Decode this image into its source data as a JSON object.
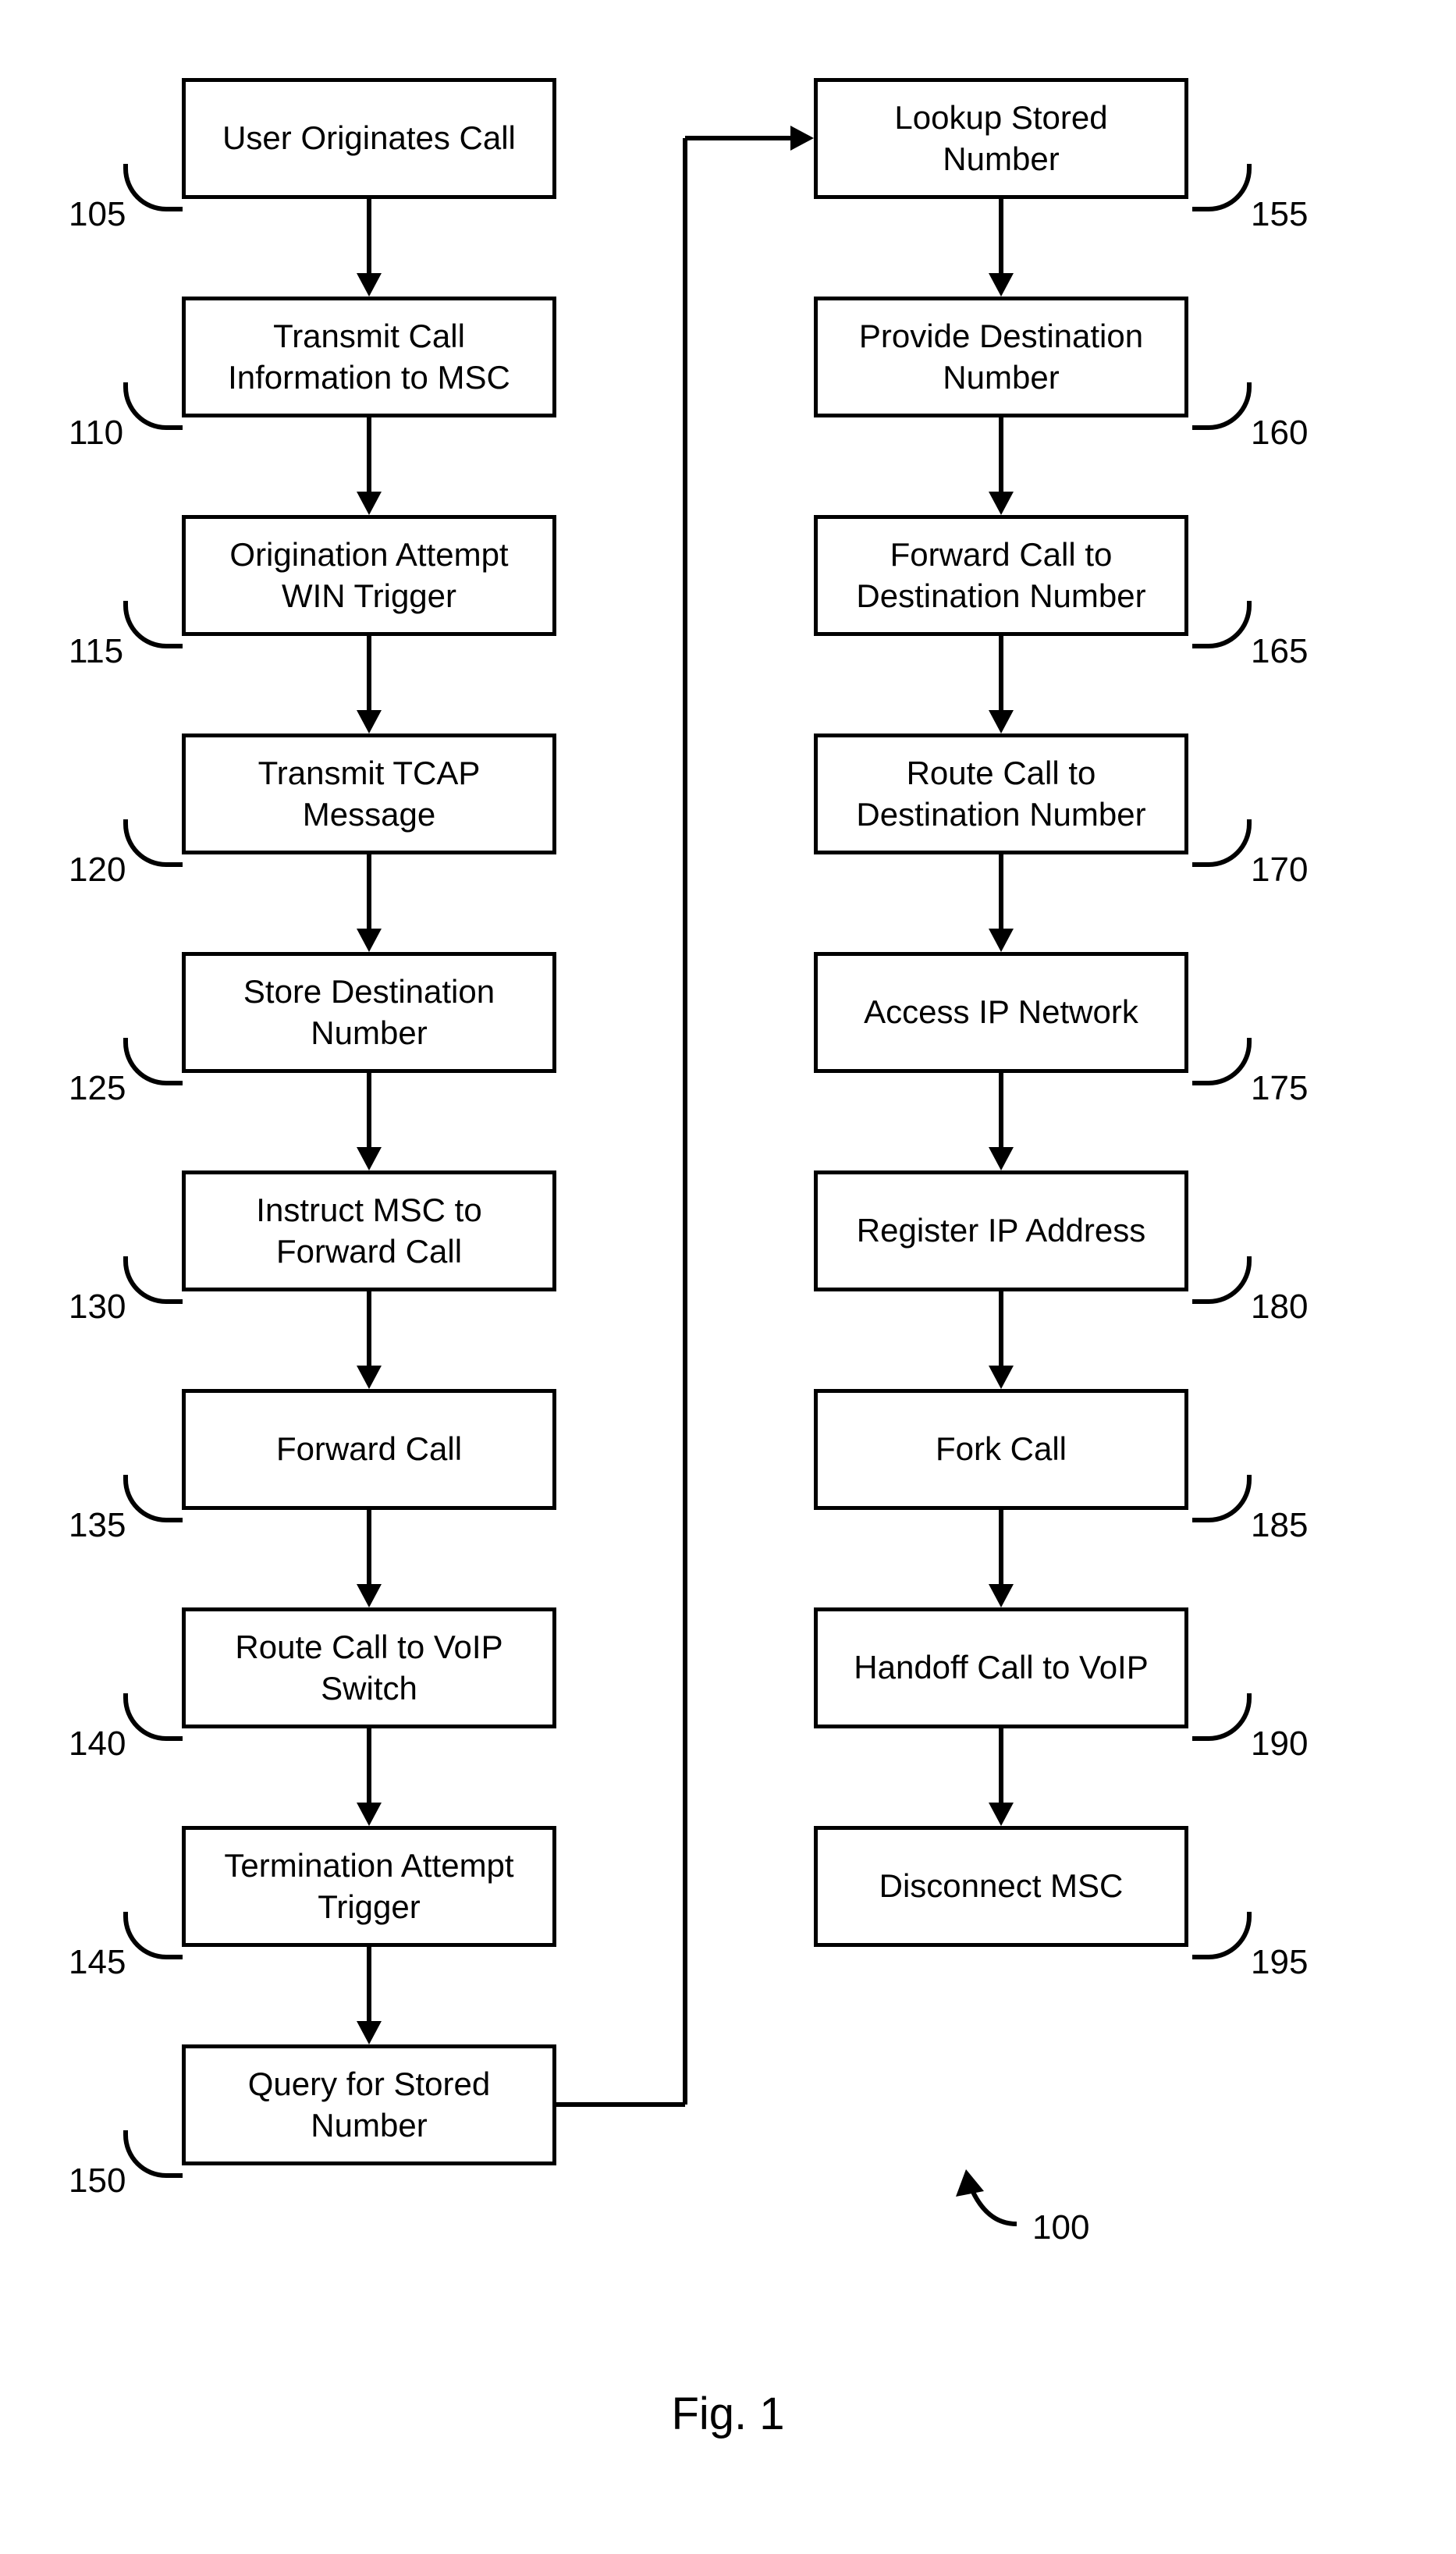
{
  "boxes": [
    {
      "id": "b105",
      "text": "User Originates Call",
      "ref": "105"
    },
    {
      "id": "b110",
      "text": "Transmit Call Information to MSC",
      "ref": "110"
    },
    {
      "id": "b115",
      "text": "Origination Attempt WIN Trigger",
      "ref": "115"
    },
    {
      "id": "b120",
      "text": "Transmit TCAP Message",
      "ref": "120"
    },
    {
      "id": "b125",
      "text": "Store Destination Number",
      "ref": "125"
    },
    {
      "id": "b130",
      "text": "Instruct MSC to Forward Call",
      "ref": "130"
    },
    {
      "id": "b135",
      "text": "Forward Call",
      "ref": "135"
    },
    {
      "id": "b140",
      "text": "Route Call to VoIP Switch",
      "ref": "140"
    },
    {
      "id": "b145",
      "text": "Termination Attempt Trigger",
      "ref": "145"
    },
    {
      "id": "b150",
      "text": "Query for Stored Number",
      "ref": "150"
    },
    {
      "id": "b155",
      "text": "Lookup Stored Number",
      "ref": "155"
    },
    {
      "id": "b160",
      "text": "Provide Destination Number",
      "ref": "160"
    },
    {
      "id": "b165",
      "text": "Forward Call to Destination Number",
      "ref": "165"
    },
    {
      "id": "b170",
      "text": "Route Call to Destination Number",
      "ref": "170"
    },
    {
      "id": "b175",
      "text": "Access IP Network",
      "ref": "175"
    },
    {
      "id": "b180",
      "text": "Register IP Address",
      "ref": "180"
    },
    {
      "id": "b185",
      "text": "Fork Call",
      "ref": "185"
    },
    {
      "id": "b190",
      "text": "Handoff Call to VoIP",
      "ref": "190"
    },
    {
      "id": "b195",
      "text": "Disconnect MSC",
      "ref": "195"
    }
  ],
  "figure_ref": "100",
  "figure_label": "Fig. 1"
}
